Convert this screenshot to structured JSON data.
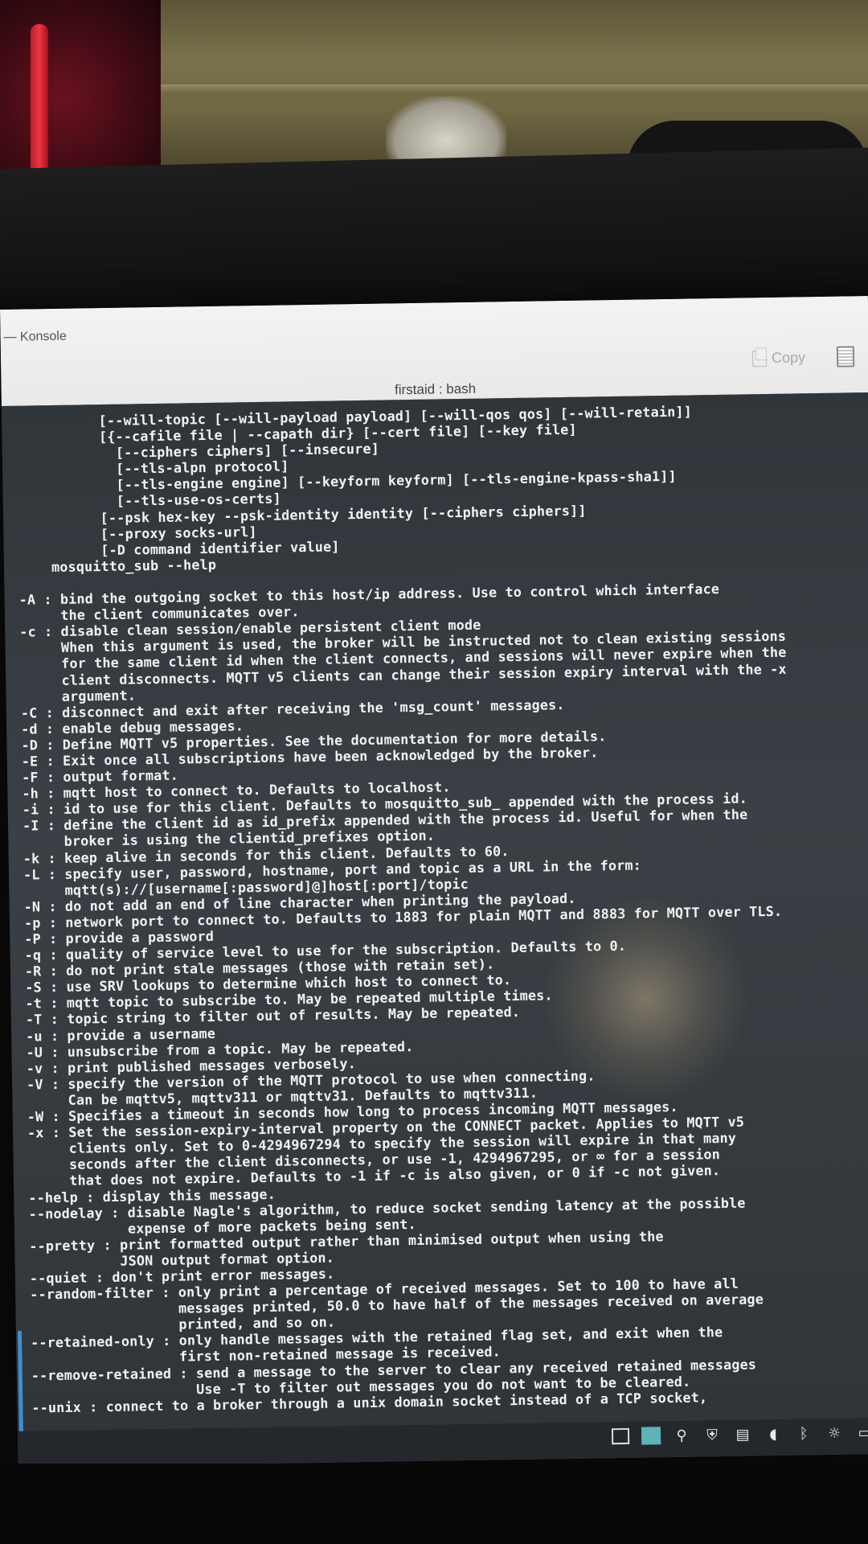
{
  "window": {
    "title": "— Konsole",
    "tab_title": "firstaid : bash",
    "toolbar": {
      "copy_label": "Copy"
    }
  },
  "terminal": {
    "lines": [
      "          [--will-topic [--will-payload payload] [--will-qos qos] [--will-retain]]",
      "          [{--cafile file | --capath dir} [--cert file] [--key file]",
      "            [--ciphers ciphers] [--insecure]",
      "            [--tls-alpn protocol]",
      "            [--tls-engine engine] [--keyform keyform] [--tls-engine-kpass-sha1]]",
      "            [--tls-use-os-certs]",
      "          [--psk hex-key --psk-identity identity [--ciphers ciphers]]",
      "          [--proxy socks-url]",
      "          [-D command identifier value]",
      "    mosquitto_sub --help",
      "",
      "-A : bind the outgoing socket to this host/ip address. Use to control which interface",
      "     the client communicates over.",
      "-c : disable clean session/enable persistent client mode",
      "     When this argument is used, the broker will be instructed not to clean existing sessions",
      "     for the same client id when the client connects, and sessions will never expire when the",
      "     client disconnects. MQTT v5 clients can change their session expiry interval with the -x",
      "     argument.",
      "-C : disconnect and exit after receiving the 'msg_count' messages.",
      "-d : enable debug messages.",
      "-D : Define MQTT v5 properties. See the documentation for more details.",
      "-E : Exit once all subscriptions have been acknowledged by the broker.",
      "-F : output format.",
      "-h : mqtt host to connect to. Defaults to localhost.",
      "-i : id to use for this client. Defaults to mosquitto_sub_ appended with the process id.",
      "-I : define the client id as id_prefix appended with the process id. Useful for when the",
      "     broker is using the clientid_prefixes option.",
      "-k : keep alive in seconds for this client. Defaults to 60.",
      "-L : specify user, password, hostname, port and topic as a URL in the form:",
      "     mqtt(s)://[username[:password]@]host[:port]/topic",
      "-N : do not add an end of line character when printing the payload.",
      "-p : network port to connect to. Defaults to 1883 for plain MQTT and 8883 for MQTT over TLS.",
      "-P : provide a password",
      "-q : quality of service level to use for the subscription. Defaults to 0.",
      "-R : do not print stale messages (those with retain set).",
      "-S : use SRV lookups to determine which host to connect to.",
      "-t : mqtt topic to subscribe to. May be repeated multiple times.",
      "-T : topic string to filter out of results. May be repeated.",
      "-u : provide a username",
      "-U : unsubscribe from a topic. May be repeated.",
      "-v : print published messages verbosely.",
      "-V : specify the version of the MQTT protocol to use when connecting.",
      "     Can be mqttv5, mqttv311 or mqttv31. Defaults to mqttv311.",
      "-W : Specifies a timeout in seconds how long to process incoming MQTT messages.",
      "-x : Set the session-expiry-interval property on the CONNECT packet. Applies to MQTT v5",
      "     clients only. Set to 0-4294967294 to specify the session will expire in that many",
      "     seconds after the client disconnects, or use -1, 4294967295, or ∞ for a session",
      "     that does not expire. Defaults to -1 if -c is also given, or 0 if -c not given.",
      "--help : display this message.",
      "--nodelay : disable Nagle's algorithm, to reduce socket sending latency at the possible",
      "            expense of more packets being sent.",
      "--pretty : print formatted output rather than minimised output when using the",
      "           JSON output format option.",
      "--quiet : don't print error messages.",
      "--random-filter : only print a percentage of received messages. Set to 100 to have all",
      "                  messages printed, 50.0 to have half of the messages received on average",
      "                  printed, and so on.",
      "--retained-only : only handle messages with the retained flag set, and exit when the",
      "                  first non-retained message is received.",
      "--remove-retained : send a message to the server to clear any received retained messages",
      "                    Use -T to filter out messages you do not want to be cleared.",
      "--unix : connect to a broker through a unix domain socket instead of a TCP socket,"
    ]
  },
  "tray": {
    "icons": [
      "window-icon",
      "pager-icon",
      "network-icon",
      "shield-icon",
      "clipboard-icon",
      "volume-icon",
      "bluetooth-icon",
      "brightness-icon",
      "show-desktop-icon"
    ]
  }
}
